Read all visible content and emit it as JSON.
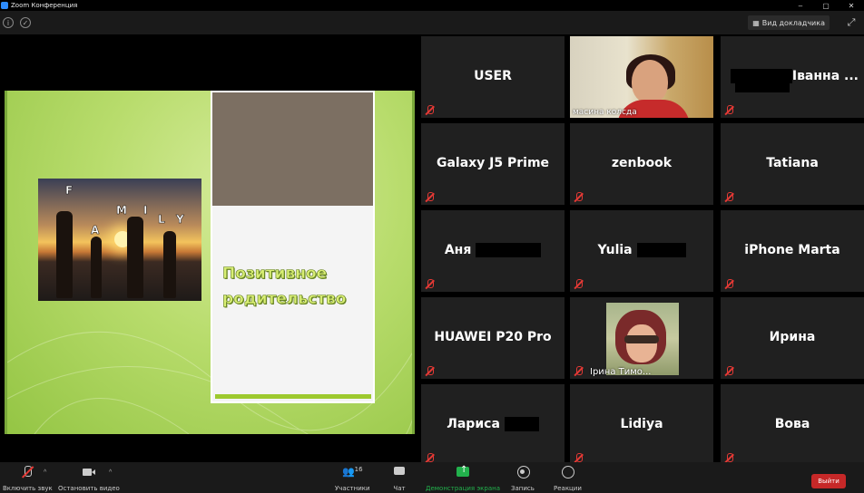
{
  "window": {
    "title": "Zoom Конференция",
    "controls": [
      "–",
      "▢",
      "✕"
    ]
  },
  "infobar": {
    "view_label": "Вид докладчика"
  },
  "slide": {
    "title": "Позитивное родительство",
    "photo_letters": [
      "F",
      "A",
      "M",
      "I",
      "L",
      "Y"
    ]
  },
  "participants": [
    {
      "name": "USER",
      "muted": true
    },
    {
      "name": "",
      "label": "масина колсда",
      "video": true
    },
    {
      "name": "Іванна ...",
      "muted": true,
      "redacted": true
    },
    {
      "name": "Galaxy J5 Prime",
      "muted": true
    },
    {
      "name": "zenbook",
      "muted": true
    },
    {
      "name": "Tatiana",
      "muted": true
    },
    {
      "name": "Аня",
      "muted": true,
      "redacted": true
    },
    {
      "name": "Yulia",
      "muted": true,
      "redacted": true
    },
    {
      "name": "iPhone Marta",
      "muted": true
    },
    {
      "name": "HUAWEI P20 Pro",
      "muted": true
    },
    {
      "name": "",
      "label": "Ірина Тимо...",
      "muted": true,
      "avatar": true
    },
    {
      "name": "Ирина",
      "muted": true
    },
    {
      "name": "Лариса",
      "muted": true,
      "redacted": true
    },
    {
      "name": "Lidiya",
      "muted": true
    },
    {
      "name": "Вова",
      "muted": true
    }
  ],
  "toolbar": {
    "mute_label": "Включить звук",
    "video_label": "Остановить видео",
    "participants_label": "Участники",
    "participants_count": "16",
    "chat_label": "Чат",
    "share_label": "Демонстрация экрана",
    "record_label": "Запись",
    "reactions_label": "Реакции",
    "leave_label": "Выйти"
  },
  "colors": {
    "mute_red": "#e53935",
    "share_green": "#22b14c",
    "leave_red": "#c62828"
  }
}
